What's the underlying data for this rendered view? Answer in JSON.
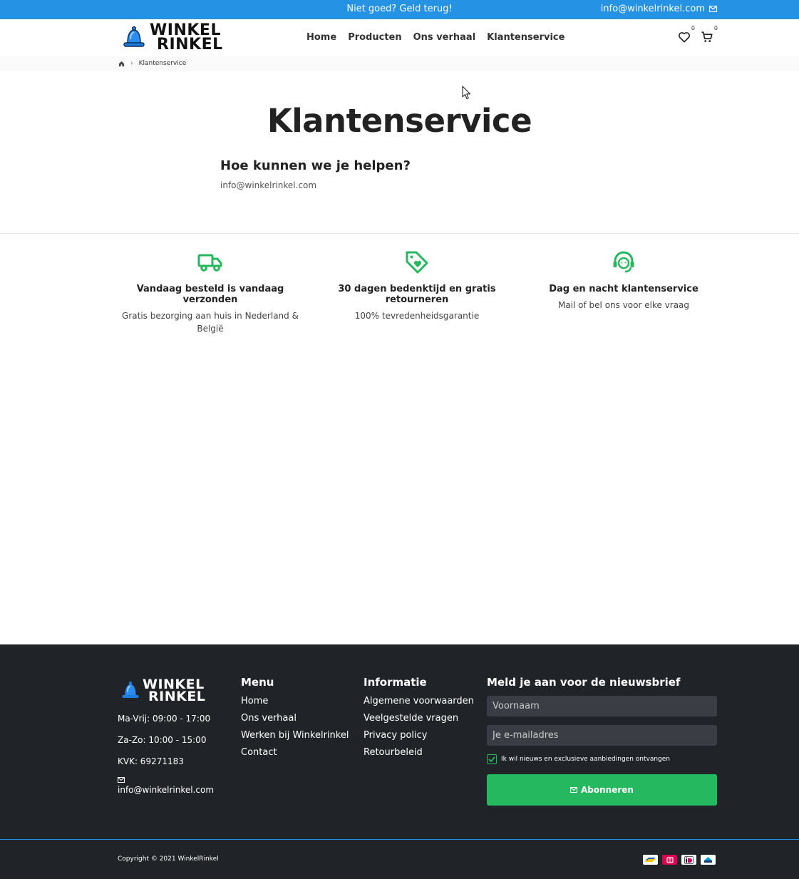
{
  "topbar": {
    "promo": "Niet goed? Geld terug!",
    "email": "info@winkelrinkel.com",
    "mail_icon": "mail-icon"
  },
  "header": {
    "logo_line1": "WINKEL",
    "logo_line2": "RINKEL",
    "nav": [
      "Home",
      "Producten",
      "Ons verhaal",
      "Klantenservice"
    ],
    "wishlist_count": "0",
    "cart_count": "0"
  },
  "breadcrumb": {
    "current": "Klantenservice"
  },
  "main": {
    "title": "Klantenservice",
    "heading": "Hoe kunnen we je helpen?",
    "email": "info@winkelrinkel.com"
  },
  "features": [
    {
      "icon": "truck-icon",
      "title": "Vandaag besteld is vandaag verzonden",
      "text": "Gratis bezorging aan huis in Nederland & België"
    },
    {
      "icon": "tag-heart-icon",
      "title": "30 dagen bedenktijd en gratis retourneren",
      "text": "100% tevredenheidsgarantie"
    },
    {
      "icon": "headset-icon",
      "title": "Dag en nacht klantenservice",
      "text": "Mail of bel ons voor elke vraag"
    }
  ],
  "footer": {
    "logo_line1": "WINKEL",
    "logo_line2": "RINKEL",
    "hours_weekdays": "Ma-Vrij: 09:00 - 17:00",
    "hours_weekend": "Za-Zo: 10:00 - 15:00",
    "kvk": "KVK: 69271183",
    "email": "info@winkelrinkel.com",
    "menu": {
      "title": "Menu",
      "links": [
        "Home",
        "Ons verhaal",
        "Werken bij Winkelrinkel",
        "Contact"
      ]
    },
    "info": {
      "title": "Informatie",
      "links": [
        "Algemene voorwaarden",
        "Veelgestelde vragen",
        "Privacy policy",
        "Retourbeleid"
      ]
    },
    "newsletter": {
      "title": "Meld je aan voor de nieuwsbrief",
      "first_name_placeholder": "Voornaam",
      "email_placeholder": "Je e-mailadres",
      "consent": "Ik wil nieuws en exclusieve aanbiedingen ontvangen",
      "consent_checked": true,
      "button": "Abonneren"
    },
    "copyright": "Copyright © 2021 WinkelRinkel",
    "payment_icons": [
      "bancontact-icon",
      "b-icon",
      "ideal-icon",
      "kbc-icon"
    ]
  },
  "colors": {
    "topbar": "#2592e3",
    "accent_green": "#25b85f",
    "footer_bg": "#202428",
    "bell_blue": "#1e7ee0"
  }
}
